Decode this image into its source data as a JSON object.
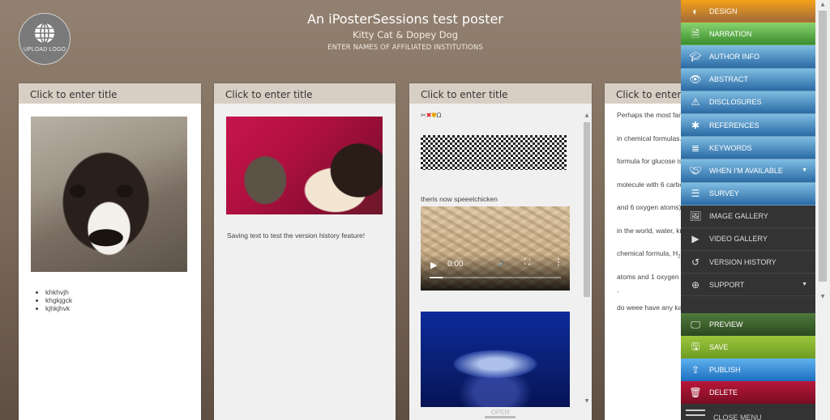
{
  "logo": {
    "label": "UPLOAD LOGO",
    "icon": "globe-icon"
  },
  "header": {
    "title": "An iPosterSessions test poster",
    "authors": "Kitty Cat & Dopey Dog",
    "institutions": "ENTER NAMES OF AFFILIATED INSTITUTIONS"
  },
  "panels": [
    {
      "title": "Click to enter title",
      "image_alt": "dog photo",
      "list": [
        "khkhvjh",
        "khgkjgck",
        "kjhkjhvk"
      ]
    },
    {
      "title": "Click to enter title",
      "image_alt": "cat and dog photo",
      "text": "Saving text  to test the version history feature!"
    },
    {
      "title": "Click to enter title",
      "symbols": {
        "scissors": "✂",
        "x": "✖",
        "shield": "⛊",
        "omega": "Ω"
      },
      "caption": "theris now speeelchicken",
      "video": {
        "time": "0:00",
        "progress": 0.1
      },
      "open_label": "OPEN"
    },
    {
      "title": "Click to enter title",
      "lines": [
        "Perhaps the most fam",
        "in chemical formulas.",
        "formula for glucose is",
        "molecule with 6 carbo",
        "and 6 oxygen atoms).",
        "in the world, water, kn",
        "chemical formula, H",
        "atoms and 1 oxygen a",
        ".",
        "do weee have any ka"
      ],
      "subscript": "2"
    }
  ],
  "menu": {
    "items": [
      {
        "label": "DESIGN",
        "icon": "contrast-icon"
      },
      {
        "label": "NARRATION",
        "icon": "audio-file-icon"
      },
      {
        "label": "AUTHOR INFO",
        "icon": "graduation-cap-icon"
      },
      {
        "label": "ABSTRACT",
        "icon": "eye-icon"
      },
      {
        "label": "DISCLOSURES",
        "icon": "warning-icon"
      },
      {
        "label": "REFERENCES",
        "icon": "asterisk-icon"
      },
      {
        "label": "KEYWORDS",
        "icon": "database-icon"
      },
      {
        "label": "WHEN I'M AVAILABLE",
        "icon": "handshake-icon"
      },
      {
        "label": "SURVEY",
        "icon": "list-icon"
      },
      {
        "label": "IMAGE GALLERY",
        "icon": "image-icon"
      },
      {
        "label": "VIDEO GALLERY",
        "icon": "video-camera-icon"
      },
      {
        "label": "VERSION HISTORY",
        "icon": "history-icon"
      },
      {
        "label": "SUPPORT",
        "icon": "lifebuoy-icon"
      }
    ],
    "actions": [
      {
        "label": "PREVIEW",
        "icon": "monitor-icon"
      },
      {
        "label": "SAVE",
        "icon": "floppy-icon"
      },
      {
        "label": "PUBLISH",
        "icon": "upload-icon"
      },
      {
        "label": "DELETE",
        "icon": "trash-icon"
      }
    ],
    "close_label": "CLOSE MENU"
  }
}
